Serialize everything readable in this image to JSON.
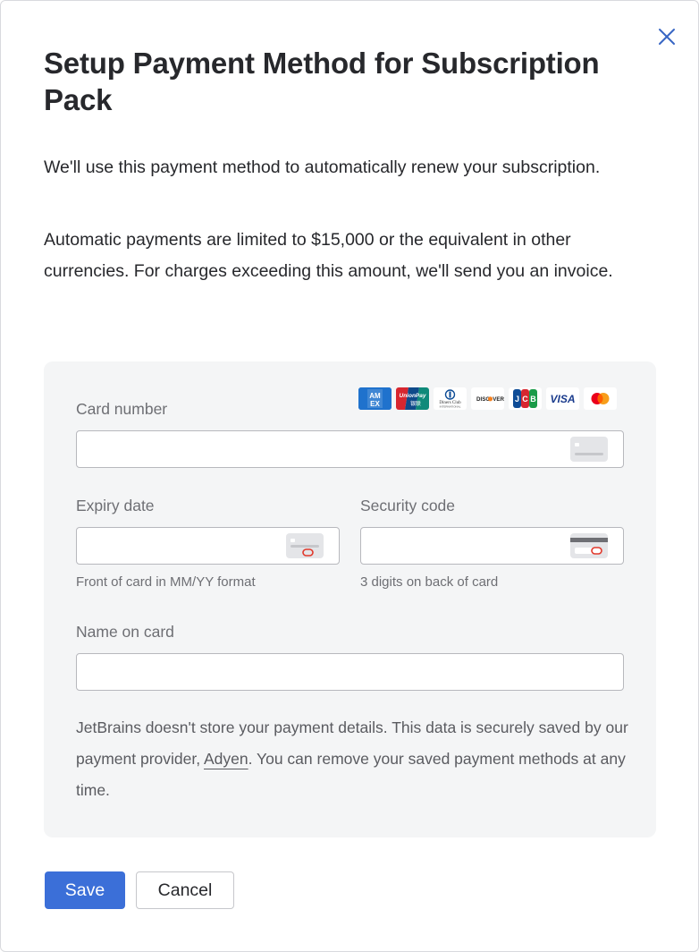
{
  "dialog": {
    "title": "Setup Payment Method for Subscription Pack",
    "paragraph_1": "We'll use this payment method to automatically renew your subscription.",
    "paragraph_2": "Automatic payments are limited to $15,000 or the equivalent in other currencies. For charges exceeding this amount, we'll send you an invoice.",
    "close_icon": "close-icon"
  },
  "form": {
    "card_number": {
      "label": "Card number",
      "value": "",
      "icon": "card-front-icon"
    },
    "card_brands": [
      "AMEX",
      "UnionPay",
      "Diners Club",
      "DISCOVER",
      "JCB",
      "VISA",
      "Mastercard"
    ],
    "expiry_date": {
      "label": "Expiry date",
      "value": "",
      "hint": "Front of card in MM/YY format",
      "icon": "card-expiry-icon"
    },
    "security_code": {
      "label": "Security code",
      "value": "",
      "hint": "3 digits on back of card",
      "icon": "card-back-cvc-icon"
    },
    "name_on_card": {
      "label": "Name on card",
      "value": ""
    },
    "notice_before": "JetBrains doesn't store your payment details. This data is securely saved by our payment provider, ",
    "notice_link": "Adyen",
    "notice_after": ". You can remove your saved payment methods at any time."
  },
  "actions": {
    "save_label": "Save",
    "cancel_label": "Cancel"
  },
  "colors": {
    "primary": "#3b6fd8",
    "panel_bg": "#f4f5f6",
    "cvc_highlight": "#e1392c"
  }
}
